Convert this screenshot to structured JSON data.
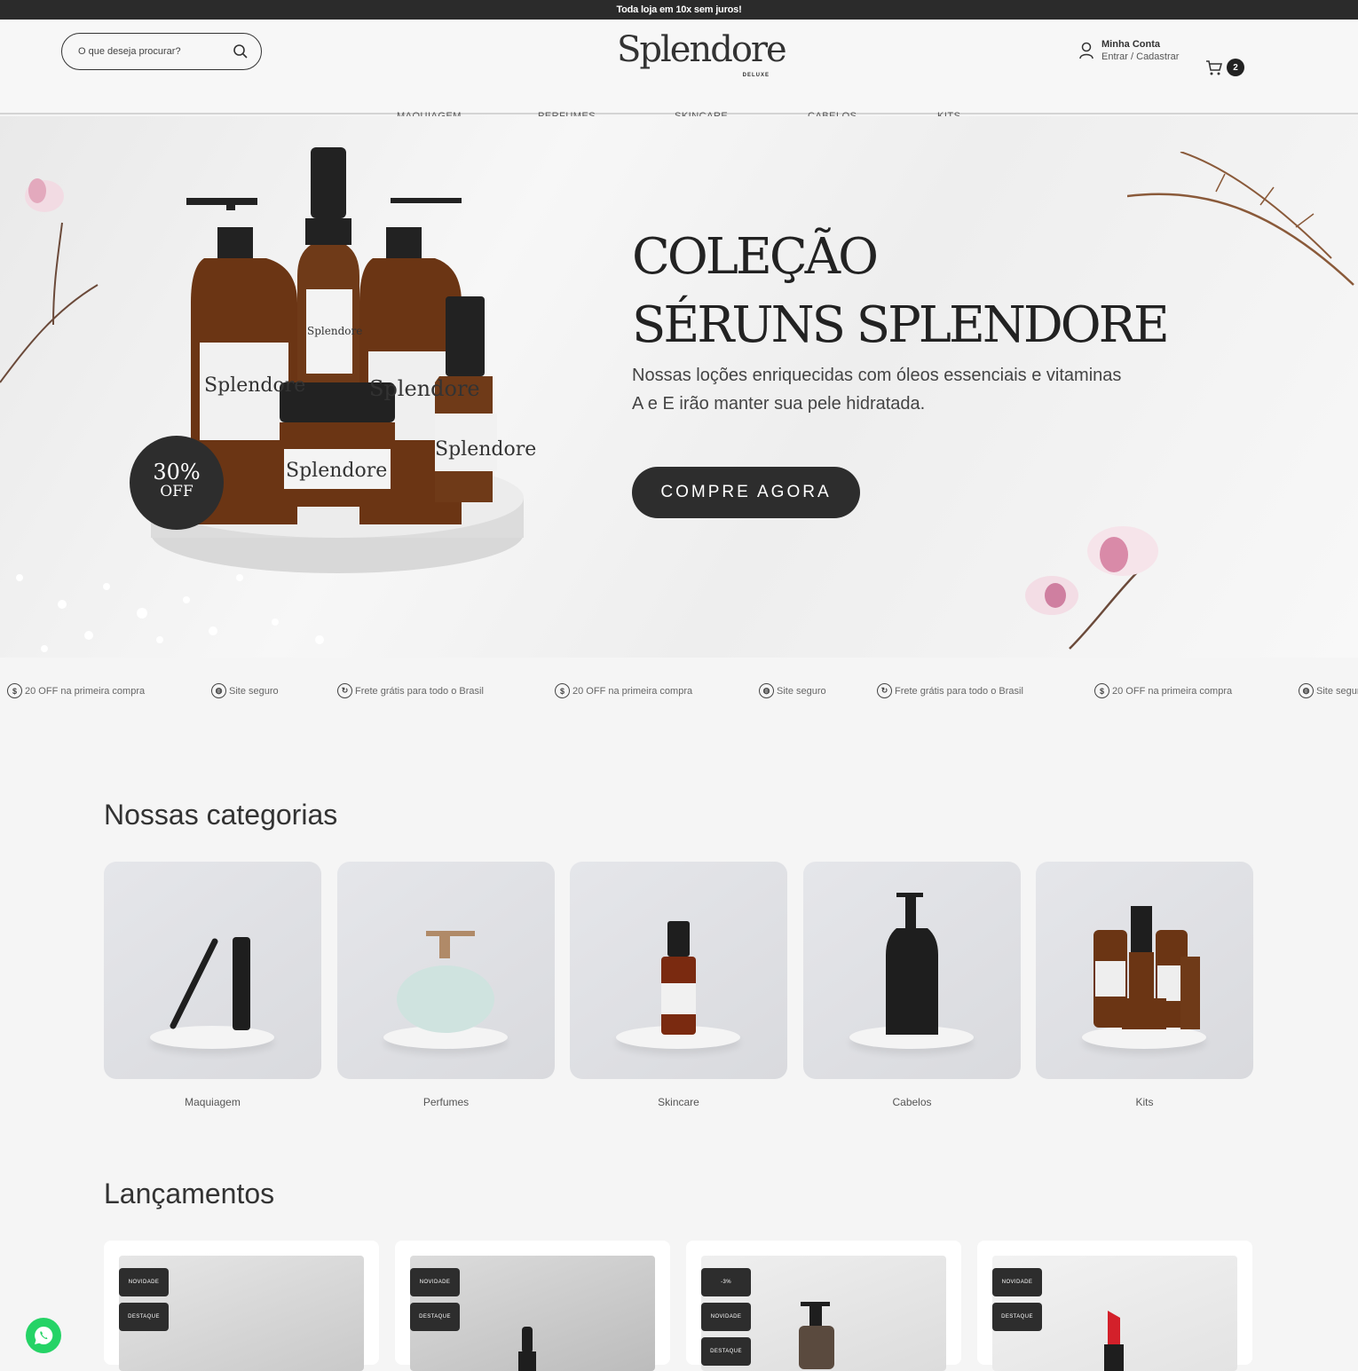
{
  "topbar": {
    "text": "Toda loja em 10x sem juros!"
  },
  "header": {
    "search_placeholder": "O que deseja procurar?",
    "logo": "Splendore",
    "logo_sub": "DELUXE",
    "account_title": "Minha Conta",
    "account_sub": "Entrar / Cadastrar",
    "cart_count": "2"
  },
  "nav": [
    "MAQUIAGEM",
    "PERFUMES",
    "SKINCARE",
    "CABELOS",
    "KITS"
  ],
  "hero": {
    "title_line1": "COLEÇÃO",
    "title_line2": "SÉRUNS SPLENDORE",
    "description": "Nossas loções enriquecidas com óleos essenciais e vitaminas A e E irão manter sua pele hidratada.",
    "cta": "COMPRE AGORA",
    "sale_pct": "30%",
    "sale_off": "OFF",
    "bottle_label": "Splendore"
  },
  "benefits": [
    {
      "icon": "$",
      "text": "20 OFF na primeira compra"
    },
    {
      "icon": "◍",
      "text": "Site seguro"
    },
    {
      "icon": "↻",
      "text": "Frete grátis para todo o Brasil"
    },
    {
      "icon": "$",
      "text": "20 OFF na primeira compra"
    },
    {
      "icon": "◍",
      "text": "Site seguro"
    },
    {
      "icon": "↻",
      "text": "Frete grátis para todo o Brasil"
    },
    {
      "icon": "$",
      "text": "20 OFF na primeira compra"
    },
    {
      "icon": "◍",
      "text": "Site seguro"
    }
  ],
  "categories": {
    "title": "Nossas categorias",
    "items": [
      "Maquiagem",
      "Perfumes",
      "Skincare",
      "Cabelos",
      "Kits"
    ]
  },
  "launches": {
    "title": "Lançamentos",
    "cards": [
      {
        "tags": [
          "NOVIDADE",
          "DESTAQUE"
        ]
      },
      {
        "tags": [
          "NOVIDADE",
          "DESTAQUE"
        ]
      },
      {
        "tags": [
          "-3%",
          "NOVIDADE",
          "DESTAQUE"
        ]
      },
      {
        "tags": [
          "NOVIDADE",
          "DESTAQUE"
        ]
      }
    ]
  },
  "colors": {
    "dark": "#2d2d2d",
    "accent_whatsapp": "#25d366"
  }
}
